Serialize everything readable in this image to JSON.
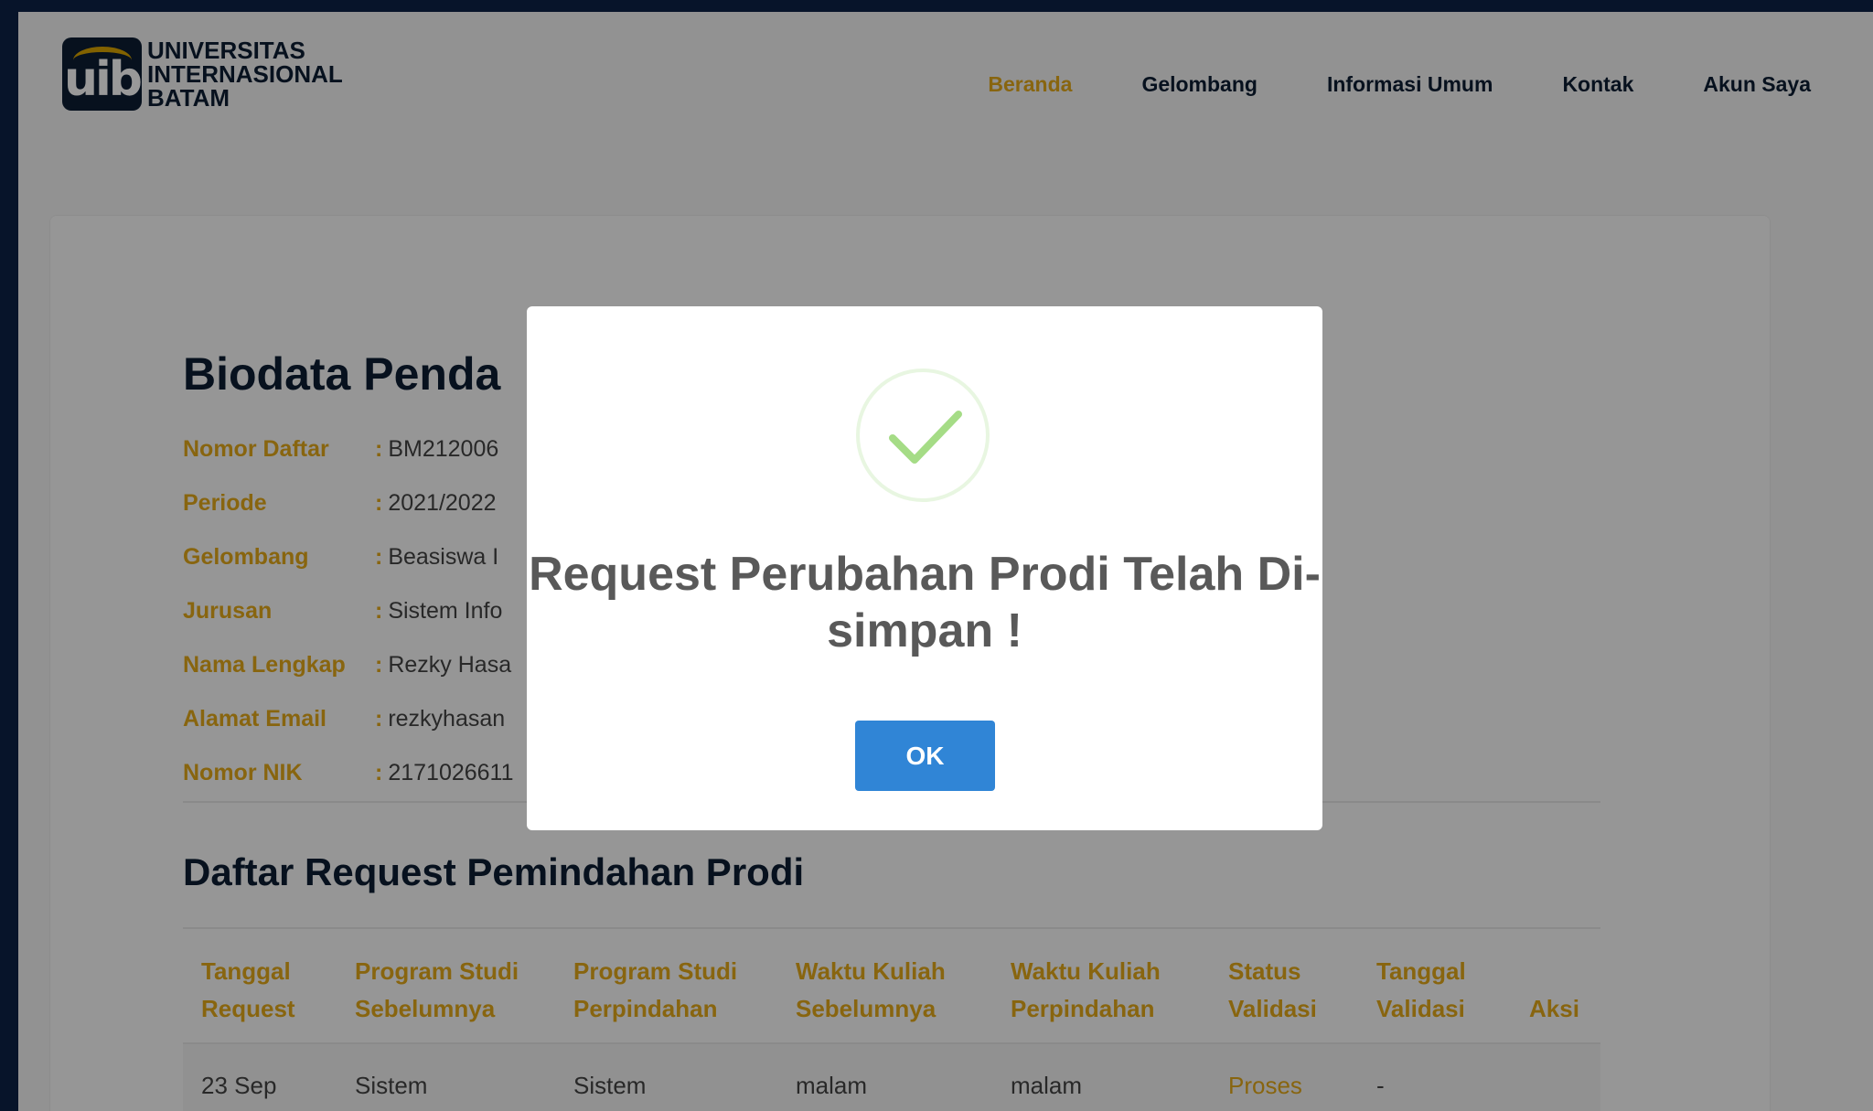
{
  "logo": {
    "mark_text": "uib",
    "line1": "UNIVERSITAS",
    "line2": "INTERNASIONAL",
    "line3": "BATAM"
  },
  "nav": {
    "items": [
      {
        "label": "Beranda",
        "active": true
      },
      {
        "label": "Gelombang",
        "active": false
      },
      {
        "label": "Informasi Umum",
        "active": false
      },
      {
        "label": "Kontak",
        "active": false
      },
      {
        "label": "Akun Saya",
        "active": false
      }
    ]
  },
  "biodata": {
    "title": "Biodata Penda",
    "rows": [
      {
        "label": "Nomor Daftar",
        "value": "BM212006"
      },
      {
        "label": "Periode",
        "value": "2021/2022"
      },
      {
        "label": "Gelombang",
        "value": "Beasiswa I"
      },
      {
        "label": "Jurusan",
        "value": "Sistem Info"
      },
      {
        "label": "Nama Lengkap",
        "value": "Rezky Hasa"
      },
      {
        "label": "Alamat Email",
        "value": "rezkyhasan"
      },
      {
        "label": "Nomor NIK",
        "value": "2171026611"
      }
    ],
    "colon": ":"
  },
  "requests": {
    "title": "Daftar Request Pemindahan Prodi",
    "headers": [
      {
        "l1": "Tanggal",
        "l2": "Request"
      },
      {
        "l1": "Program Studi",
        "l2": "Sebelumnya"
      },
      {
        "l1": "Program Studi",
        "l2": "Perpindahan"
      },
      {
        "l1": "Waktu Kuliah",
        "l2": "Sebelumnya"
      },
      {
        "l1": "Waktu Kuliah",
        "l2": "Perpindahan"
      },
      {
        "l1": "Status",
        "l2": "Validasi"
      },
      {
        "l1": "Tanggal",
        "l2": "Validasi"
      },
      {
        "l1": "",
        "l2": "Aksi"
      }
    ],
    "rows": [
      {
        "tanggal_request": "23 Sep",
        "prodi_sebelumnya": "Sistem",
        "prodi_perpindahan": "Sistem",
        "waktu_sebelumnya": "malam",
        "waktu_perpindahan": "malam",
        "status": "Proses",
        "tanggal_validasi": "-"
      }
    ]
  },
  "dialog": {
    "title": "Request Perubahan Prodi Telah Di-simpan !",
    "ok_label": "OK",
    "icon": "success-check-icon"
  },
  "colors": {
    "navy": "#0c1d33",
    "accent": "#e3a81a",
    "button": "#3085d6",
    "success": "#a5dc86"
  }
}
